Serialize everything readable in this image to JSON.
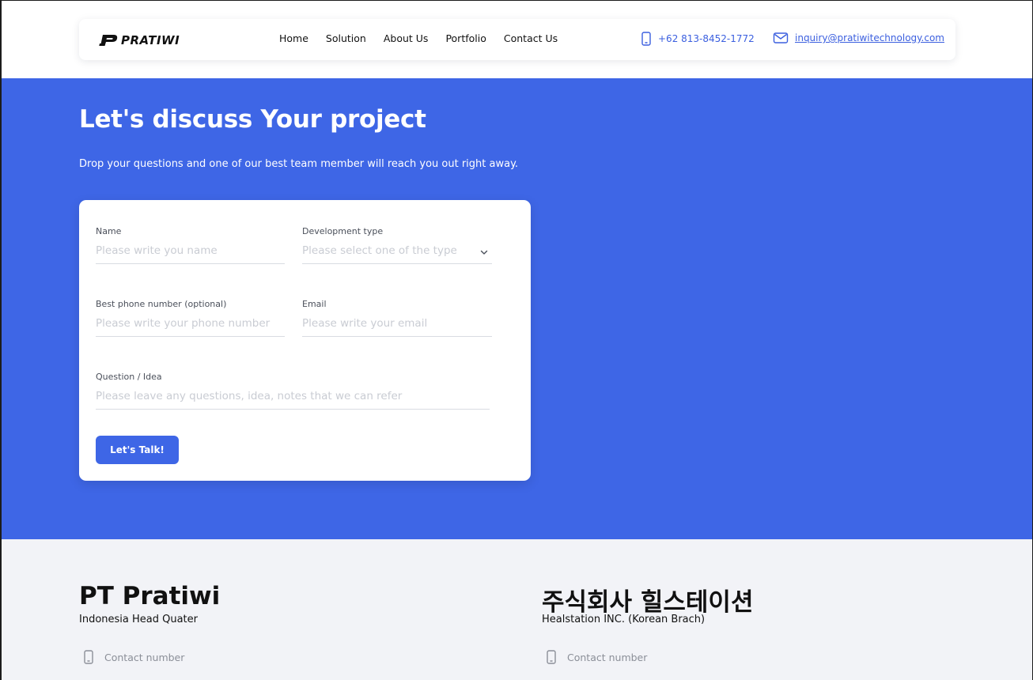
{
  "header": {
    "logo_text": "PRATIWI",
    "menu": [
      "Home",
      "Solution",
      "About Us",
      "Portfolio",
      "Contact Us"
    ],
    "phone": "+62 813-8452-1772",
    "email": "inquiry@pratiwitechnology.com"
  },
  "hero": {
    "title": "Let's discuss Your project",
    "subtitle": "Drop your questions and one of our best team member will reach you out right away."
  },
  "form": {
    "name": {
      "label": "Name",
      "placeholder": "Please write you name"
    },
    "dev_type": {
      "label": "Development type",
      "placeholder": "Please select one of the type"
    },
    "phone": {
      "label": "Best phone number (optional)",
      "placeholder": "Please write your phone number"
    },
    "email": {
      "label": "Email",
      "placeholder": "Please write your email"
    },
    "question": {
      "label": "Question / Idea",
      "placeholder": "Please leave any questions, idea, notes that we can refer"
    },
    "submit_label": "Let's Talk!"
  },
  "offices": [
    {
      "name": "PT Pratiwi",
      "location": "Indonesia Head Quater",
      "contact_label": "Contact number"
    },
    {
      "name": "주식회사 힐스테이션",
      "location": "Healstation INC. (Korean Brach)",
      "contact_label": "Contact number"
    }
  ],
  "colors": {
    "accent": "#3e66e6",
    "link": "#3b5fdf",
    "footer_bg": "#f2f3f7"
  }
}
